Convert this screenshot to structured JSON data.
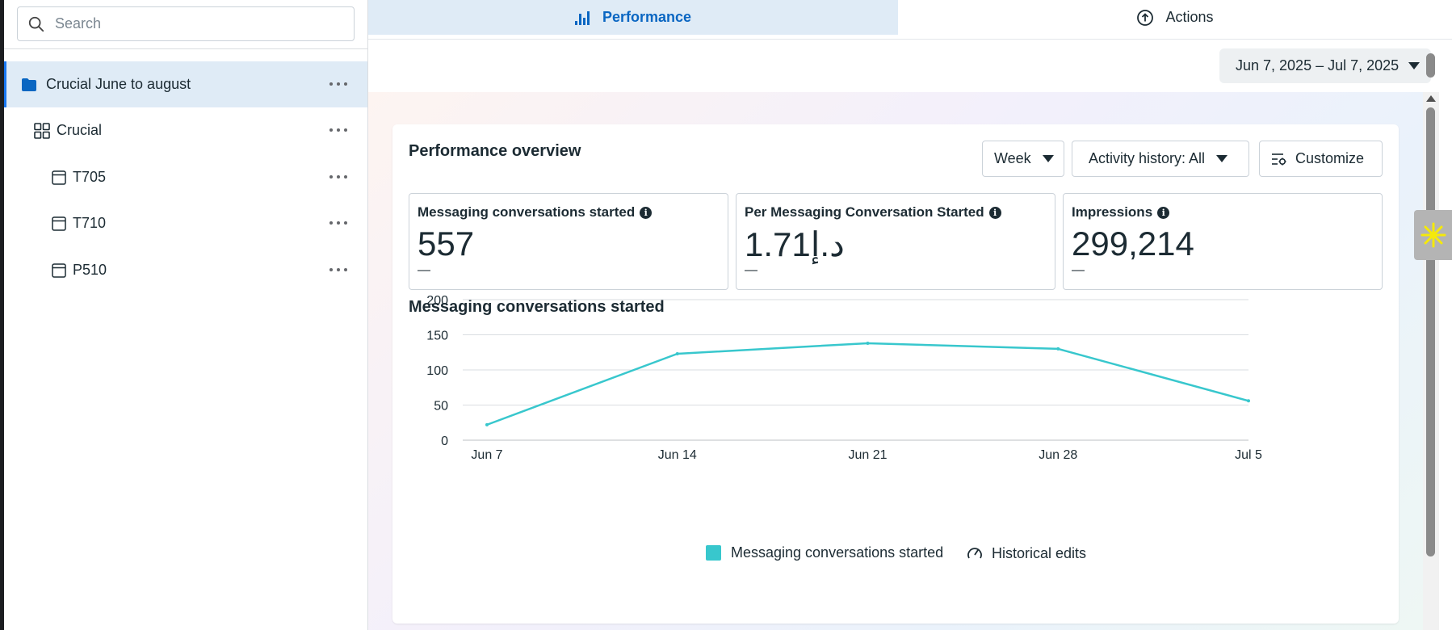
{
  "sidebar": {
    "search_placeholder": "Search",
    "items": [
      {
        "label": "Crucial June to august",
        "icon": "folder-icon",
        "active": true
      },
      {
        "label": "Crucial",
        "icon": "grid-icon"
      },
      {
        "label": "T705",
        "icon": "ad-icon"
      },
      {
        "label": "T710",
        "icon": "ad-icon"
      },
      {
        "label": "P510",
        "icon": "ad-icon"
      }
    ]
  },
  "tabs": [
    {
      "label": "Performance",
      "icon": "bar-chart-icon",
      "active": true
    },
    {
      "label": "Actions",
      "icon": "upload-circle-icon"
    }
  ],
  "date_range": "Jun 7, 2025 – Jul 7, 2025",
  "overview": {
    "title": "Performance overview",
    "week_label": "Week",
    "activity_label": "Activity history: All",
    "customize_label": "Customize"
  },
  "metrics": [
    {
      "label": "Messaging conversations started",
      "value": "557",
      "delta": "—"
    },
    {
      "label": "Per Messaging Conversation Started",
      "value": "1.71د.إ",
      "delta": "—"
    },
    {
      "label": "Impressions",
      "value": "299,214",
      "delta": "—"
    }
  ],
  "chart_title": "Messaging conversations started",
  "chart_data": {
    "type": "line",
    "x": [
      "Jun 7",
      "Jun 14",
      "Jun 21",
      "Jun 28",
      "Jul 5"
    ],
    "series": [
      {
        "name": "Messaging conversations started",
        "values": [
          22,
          123,
          138,
          130,
          56
        ],
        "color": "#38c7cd"
      }
    ],
    "yticks": [
      0,
      50,
      100,
      150,
      200
    ],
    "ylim": [
      0,
      200
    ],
    "grid": true,
    "legend": [
      "Messaging conversations started",
      "Historical edits"
    ],
    "legend_position": "bottom"
  },
  "colors": {
    "accent": "#0a66c2",
    "series": "#38c7cd",
    "active_bg": "#dfebf6"
  }
}
